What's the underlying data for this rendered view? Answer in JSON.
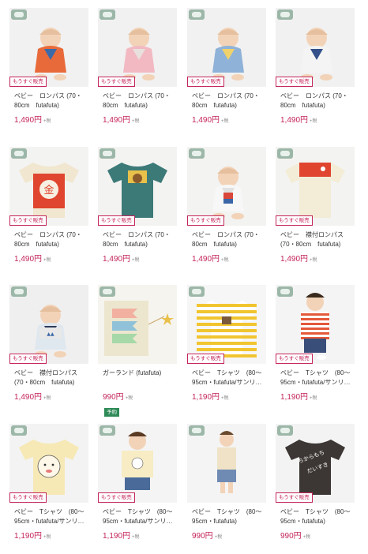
{
  "badge_label": "もうすぐ販売",
  "preorder_label": "予約",
  "tax_label": "+税",
  "products": [
    {
      "name": "ベビー　ロンパス (70・80cm　futafuta)",
      "price": "1,490円",
      "img": "baby-orange-kimono",
      "badge": true
    },
    {
      "name": "ベビー　ロンパス (70・80cm　futafuta)",
      "price": "1,490円",
      "img": "baby-pink-kimono",
      "badge": true
    },
    {
      "name": "ベビー　ロンパス (70・80cm　futafuta)",
      "price": "1,490円",
      "img": "baby-blue-kimono",
      "badge": true
    },
    {
      "name": "ベビー　ロンパス (70・80cm　futafuta)",
      "price": "1,490円",
      "img": "baby-navy-kimono",
      "badge": true
    },
    {
      "name": "ベビー　ロンパス (70・80cm　futafuta)",
      "price": "1,490円",
      "img": "red-kintaro-romper",
      "badge": true
    },
    {
      "name": "ベビー　ロンパス (70・80cm　futafuta)",
      "price": "1,490円",
      "img": "green-samurai-romper",
      "badge": true
    },
    {
      "name": "ベビー　ロンパス (70・80cm　futafuta)",
      "price": "1,490円",
      "img": "baby-white-romper",
      "badge": true
    },
    {
      "name": "ベビー　襟付ロンパス (70・80cm　futafuta)",
      "price": "1,490円",
      "img": "koinobori-romper",
      "badge": true
    },
    {
      "name": "ベビー　襟付ロンパス (70・80cm　futafuta)",
      "price": "1,490円",
      "img": "baby-collar-romper",
      "badge": true
    },
    {
      "name": "ガーランド (futafuta)",
      "price": "990円",
      "img": "koinobori-garland",
      "badge": false,
      "preorder": true
    },
    {
      "name": "ベビー　Tシャツ　(80〜95cm・futafuta/サンリ…",
      "price": "1,190円",
      "img": "yellow-stripe-tee",
      "badge": true
    },
    {
      "name": "ベビー　Tシャツ　(80〜95cm・futafuta/サンリ…",
      "price": "1,190円",
      "img": "boy-red-stripe-tee",
      "badge": true
    },
    {
      "name": "ベビー　Tシャツ　(80〜95cm・futafuta/サンリ…",
      "price": "1,190円",
      "img": "cream-face-tee",
      "badge": true
    },
    {
      "name": "ベビー　Tシャツ　(80〜95cm・futafuta/サンリ…",
      "price": "1,190円",
      "img": "boy-cream-tee",
      "badge": true
    },
    {
      "name": "ベビー　Tシャツ　(80〜95cm・futafuta)",
      "price": "990円",
      "img": "boy-beige-tee",
      "badge": false
    },
    {
      "name": "ベビー　Tシャツ　(80〜95cm・futafuta)",
      "price": "990円",
      "img": "charcoal-tee",
      "badge": true
    }
  ],
  "colors": {
    "accent": "#c4245a",
    "preorder": "#2e8b57"
  }
}
